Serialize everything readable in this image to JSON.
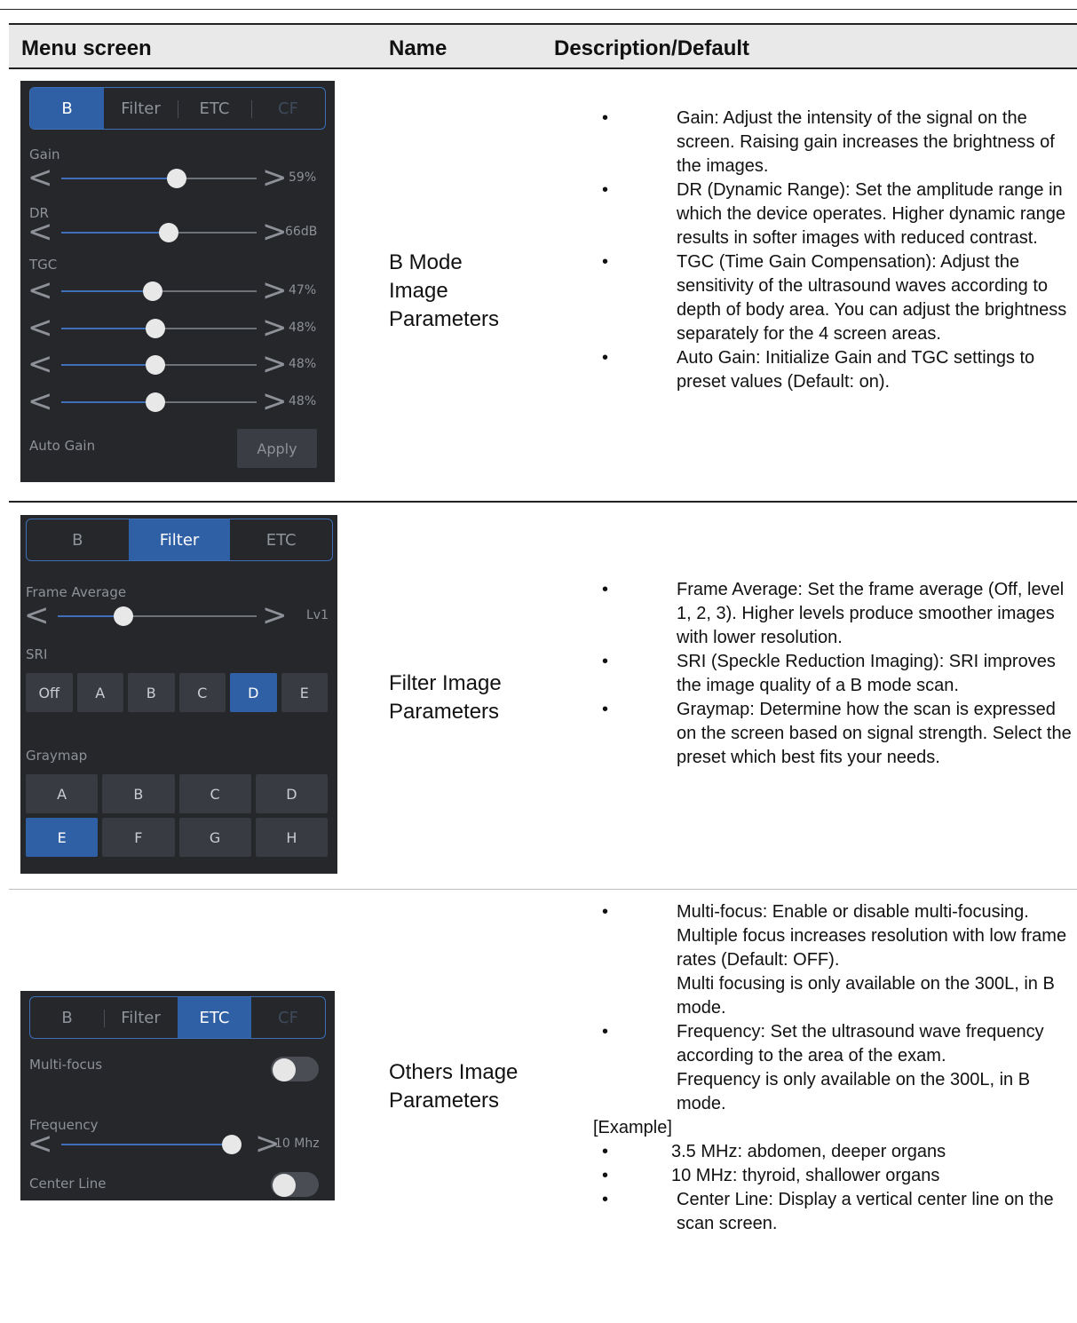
{
  "header": {
    "menu_screen": "Menu screen",
    "name": "Name",
    "description": "Description/Default"
  },
  "rows": [
    {
      "name_lines": [
        "B Mode",
        "Image",
        "Parameters"
      ],
      "panel": {
        "tabs": [
          "B",
          "Filter",
          "ETC",
          "CF"
        ],
        "active_tab": "B",
        "gain_label": "Gain",
        "gain": {
          "value_text": "59%",
          "level": 0.59
        },
        "dr_label": "DR",
        "dr": {
          "value_text": "66dB",
          "level": 0.55
        },
        "tgc_label": "TGC",
        "tgc": [
          {
            "value_text": "47%",
            "level": 0.47
          },
          {
            "value_text": "48%",
            "level": 0.48
          },
          {
            "value_text": "48%",
            "level": 0.48
          },
          {
            "value_text": "48%",
            "level": 0.48
          }
        ],
        "auto_gain_label": "Auto Gain",
        "apply_label": "Apply"
      },
      "bullets": [
        "Gain: Adjust the intensity of the signal on the screen. Raising gain increases the brightness of the images.",
        "DR (Dynamic Range): Set the amplitude range in which the device operates. Higher dynamic range results in softer images with reduced contrast.",
        "TGC (Time Gain Compensation): Adjust the sensitivity of the ultrasound waves according to depth of body area. You can adjust the brightness separately for the 4 screen areas.",
        "Auto Gain: Initialize Gain and TGC settings to preset values (Default: on)."
      ]
    },
    {
      "name_lines": [
        "Filter Image",
        "Parameters"
      ],
      "panel": {
        "tabs": [
          "B",
          "Filter",
          "ETC"
        ],
        "active_tab": "Filter",
        "frame_average_label": "Frame Average",
        "frame_average": {
          "value_text": "Lv1",
          "level": 0.33
        },
        "sri_label": "SRI",
        "sri_options": [
          "Off",
          "A",
          "B",
          "C",
          "D",
          "E"
        ],
        "sri_selected": "D",
        "graymap_label": "Graymap",
        "graymap_row1": [
          "A",
          "B",
          "C",
          "D"
        ],
        "graymap_row2": [
          "E",
          "F",
          "G",
          "H"
        ],
        "graymap_selected": "E"
      },
      "bullets": [
        "Frame Average: Set the frame average (Off, level 1, 2, 3). Higher levels produce smoother images with lower resolution.",
        "SRI (Speckle Reduction Imaging): SRI improves the image quality of a B mode scan.",
        "Graymap: Determine how the scan is expressed on the screen based on signal strength. Select the preset which best fits your needs."
      ]
    },
    {
      "name_lines": [
        "Others Image",
        "Parameters"
      ],
      "panel": {
        "tabs": [
          "B",
          "Filter",
          "ETC",
          "CF"
        ],
        "active_tab": "ETC",
        "multi_focus_label": "Multi-focus",
        "multi_focus_on": false,
        "frequency_label": "Frequency",
        "frequency": {
          "value_text": "10 Mhz",
          "level": 1.0
        },
        "center_line_label": "Center Line",
        "center_line_on": false
      },
      "items": {
        "multi_focus": "Multi-focus: Enable or disable multi-focusing. Multiple focus increases resolution with low frame rates (Default: OFF).",
        "multi_focus_note": "Multi focusing is only available on the 300L, in B mode.",
        "frequency": "Frequency: Set the ultrasound wave frequency according to the area of the exam.",
        "frequency_note": "Frequency is only available on the 300L, in B mode.",
        "example_label": "[Example]",
        "example_1": "3.5 MHz: abdomen, deeper organs",
        "example_2": "10 MHz: thyroid, shallower organs",
        "center_line": "Center Line: Display a vertical center line on the scan screen."
      }
    }
  ],
  "colors": {
    "panel_bg": "#25272b",
    "accent_blue": "#2f60a6",
    "header_bg": "#e9e9e9"
  }
}
